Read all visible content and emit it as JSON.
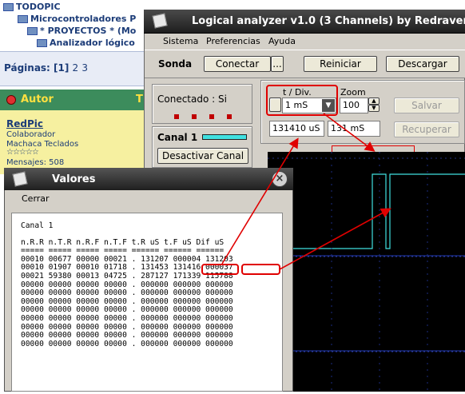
{
  "forum": {
    "tree": [
      {
        "label": "TODOPIC"
      },
      {
        "label": "Microcontroladores P"
      },
      {
        "label": "* PROYECTOS * (Mo"
      },
      {
        "label": "Analizador lógico"
      }
    ],
    "pages_label": "Páginas: [1]",
    "page_2": "2",
    "page_3": "3",
    "author_label": "Autor",
    "author_right": "T",
    "user_name": "RedPic",
    "user_role": "Colaborador",
    "user_title": "Machaca Teclados",
    "user_stars": "☆☆☆☆☆",
    "user_posts": "Mensajes: 508"
  },
  "analyzer": {
    "title": "Logical analyzer v1.0 (3 Channels) by Redraven",
    "menu": [
      "Sistema",
      "Preferencias",
      "Ayuda"
    ],
    "sonda_label": "Sonda",
    "connect_button": "Conectar",
    "ellipsis_button": "...",
    "restart_button": "Reiniciar",
    "download_button": "Descargar",
    "connected_status": "Conectado : Si",
    "tdiv_label": "t / Div.",
    "tdiv_value": "1 mS",
    "zoom_label": "Zoom",
    "zoom_value": "100",
    "save_button": "Salvar",
    "recover_button": "Recuperar",
    "time_value": "131410 uS",
    "duration_value": "131 mS",
    "channel_label": "Canal 1",
    "deactivate_button": "Desactivar Canal",
    "channel_color": "#40e0e0",
    "accent_red": "#e00000"
  },
  "valores": {
    "title": "Valores",
    "menu_close": "Cerrar",
    "channel_title": "Canal 1",
    "columns": [
      "n.R.R",
      "n.T.R",
      "n.R.F",
      "n.T.F",
      "t.R uS",
      "t.F uS",
      "Dif uS"
    ],
    "rows": [
      [
        "00010",
        "00677",
        "00000",
        "00021",
        ". 131207",
        "000004",
        "131203"
      ],
      [
        "00010",
        "01907",
        "00010",
        "01718",
        ". 131453",
        "131416",
        "000037"
      ],
      [
        "00021",
        "59380",
        "00013",
        "04725",
        ". 287127",
        "171339",
        "115788"
      ],
      [
        "00000",
        "00000",
        "00000",
        "00000",
        ". 000000",
        "000000",
        "000000"
      ],
      [
        "00000",
        "00000",
        "00000",
        "00000",
        ". 000000",
        "000000",
        "000000"
      ],
      [
        "00000",
        "00000",
        "00000",
        "00000",
        ". 000000",
        "000000",
        "000000"
      ],
      [
        "00000",
        "00000",
        "00000",
        "00000",
        ". 000000",
        "000000",
        "000000"
      ],
      [
        "00000",
        "00000",
        "00000",
        "00000",
        ". 000000",
        "000000",
        "000000"
      ],
      [
        "00000",
        "00000",
        "00000",
        "00000",
        ". 000000",
        "000000",
        "000000"
      ],
      [
        "00000",
        "00000",
        "00000",
        "00000",
        ". 000000",
        "000000",
        "000000"
      ],
      [
        "00000",
        "00000",
        "00000",
        "00000",
        ". 000000",
        "000000",
        "000000"
      ]
    ]
  }
}
